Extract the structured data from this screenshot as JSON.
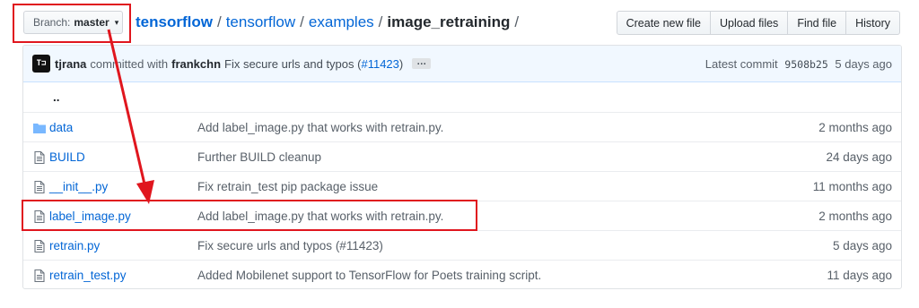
{
  "branch": {
    "prefix": "Branch:",
    "value": "master",
    "caret": "▾"
  },
  "breadcrumb": {
    "items": [
      "tensorflow",
      "tensorflow",
      "examples"
    ],
    "current": "image_retraining",
    "separator": "/"
  },
  "header_buttons": [
    "Create new file",
    "Upload files",
    "Find file",
    "History"
  ],
  "commit": {
    "avatar_text": "T⊐",
    "author": "tjrana",
    "verb": "committed with",
    "coauthor": "frankchn",
    "message": "Fix secure urls and typos (",
    "pr_link": "#11423",
    "message_end": ")",
    "ellipsis": "…",
    "latest_label": "Latest commit",
    "sha": "9508b25",
    "age": "5 days ago"
  },
  "parent_dir": "..",
  "files": [
    {
      "icon": "folder-icon",
      "name": "data",
      "message": "Add label_image.py that works with retrain.py.",
      "age": "2 months ago"
    },
    {
      "icon": "file-icon",
      "name": "BUILD",
      "message": "Further BUILD cleanup",
      "age": "24 days ago"
    },
    {
      "icon": "file-icon",
      "name": "__init__.py",
      "message": "Fix retrain_test pip package issue",
      "age": "11 months ago"
    },
    {
      "icon": "file-icon",
      "name": "label_image.py",
      "message": "Add label_image.py that works with retrain.py.",
      "age": "2 months ago"
    },
    {
      "icon": "file-icon",
      "name": "retrain.py",
      "message": "Fix secure urls and typos (#11423)",
      "age": "5 days ago"
    },
    {
      "icon": "file-icon",
      "name": "retrain_test.py",
      "message": "Added Mobilenet support to TensorFlow for Poets training script.",
      "age": "11 days ago"
    }
  ],
  "annotation_color": "#e0161e",
  "link_color": "#0366d6"
}
